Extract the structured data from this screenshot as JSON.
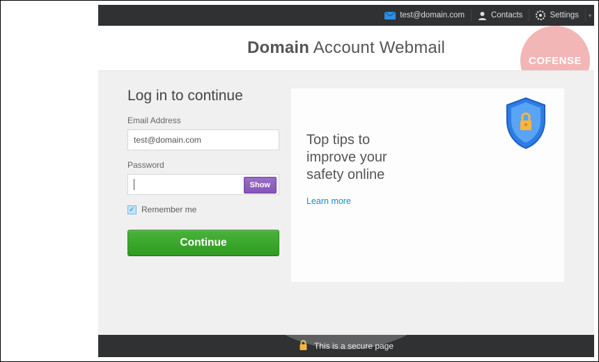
{
  "topbar": {
    "email": "test@domain.com",
    "contacts": "Contacts",
    "settings": "Settings"
  },
  "title": {
    "bold": "Domain",
    "rest": " Account Webmail"
  },
  "watermark": "COFENSE",
  "login": {
    "heading": "Log in to continue",
    "email_label": "Email Address",
    "email_value": "test@domain.com",
    "password_label": "Password",
    "show_btn": "Show",
    "remember": "Remember me",
    "continue": "Continue"
  },
  "tips": {
    "line1": "Top tips to",
    "line2": "improve your",
    "line3": "safety online",
    "learn_more": "Learn more"
  },
  "footer": {
    "text": "This is a secure page"
  },
  "colors": {
    "accent_green": "#3aa82c",
    "accent_purple": "#8a5bba",
    "link_blue": "#1a8bbf",
    "brand_red": "#e24a4a"
  }
}
